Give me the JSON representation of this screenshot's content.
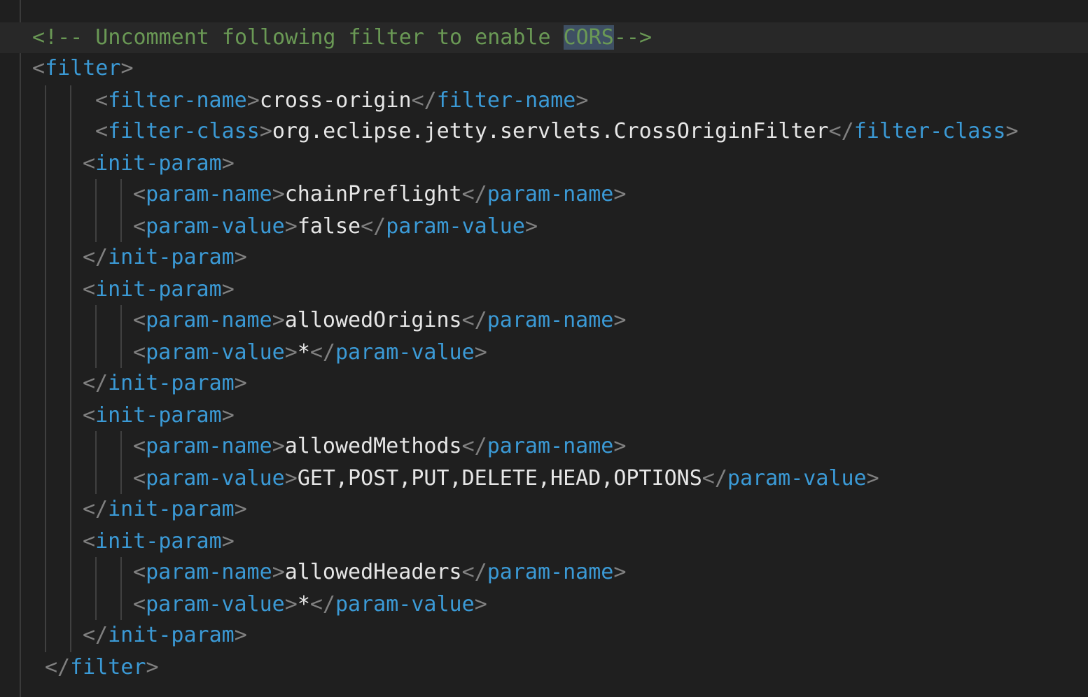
{
  "editor": {
    "comment": {
      "prefix": "<!-- Uncomment following filter to enable ",
      "highlight": "CORS",
      "suffix": "-->"
    },
    "filter_open": "filter",
    "filter_name": {
      "tag": "filter-name",
      "value": "cross-origin"
    },
    "filter_class": {
      "tag": "filter-class",
      "value": "org.eclipse.jetty.servlets.CrossOriginFilter"
    },
    "init_param_tag": "init-param",
    "param_name_tag": "param-name",
    "param_value_tag": "param-value",
    "params": [
      {
        "name": "chainPreflight",
        "value": "false"
      },
      {
        "name": "allowedOrigins",
        "value": "*"
      },
      {
        "name": "allowedMethods",
        "value": "GET,POST,PUT,DELETE,HEAD,OPTIONS"
      },
      {
        "name": "allowedHeaders",
        "value": "*"
      }
    ],
    "filter_close": "filter"
  }
}
